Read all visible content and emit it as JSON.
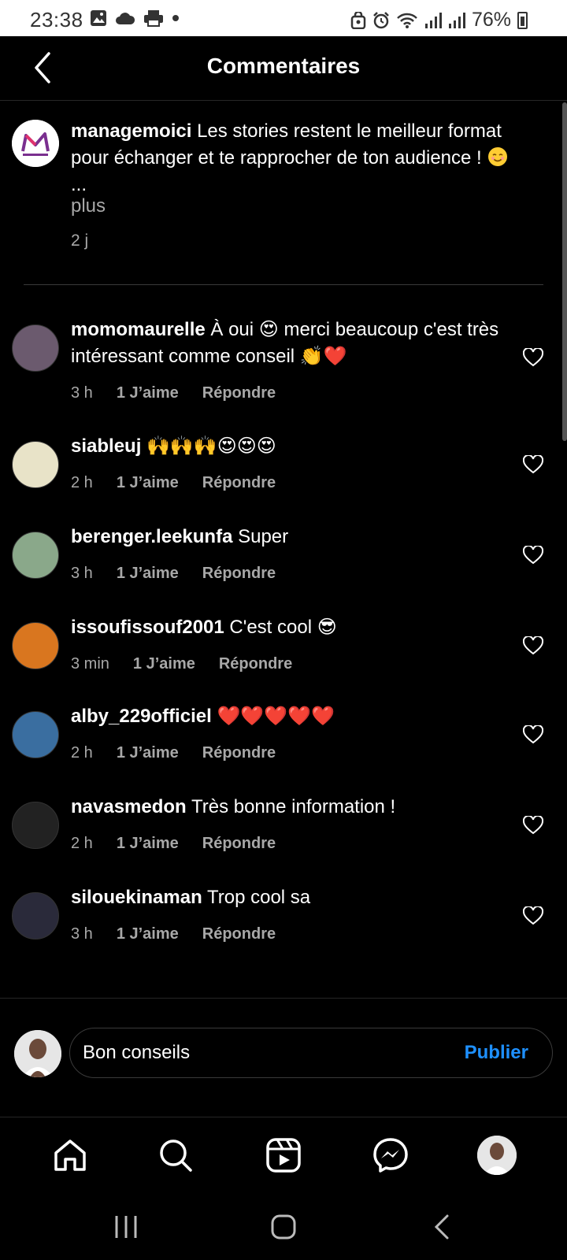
{
  "status_bar": {
    "time": "23:38",
    "battery": "76%"
  },
  "header": {
    "title": "Commentaires"
  },
  "caption": {
    "username": "managemoici",
    "text": "Les stories restent le meilleur format pour échanger et te rapprocher de ton audience !",
    "ellipsis": "...",
    "more": "plus",
    "age": "2 j"
  },
  "comments": [
    {
      "username": "momomaurelle",
      "text": "À oui 😍 merci beaucoup c'est très intéressant comme conseil 👏❤️",
      "age": "3 h",
      "likes": "1 J’aime",
      "reply": "Répondre",
      "avatar_color": "#6b5a6e"
    },
    {
      "username": "siableuj",
      "text": "🙌🙌🙌😍😍😍",
      "age": "2 h",
      "likes": "1 J’aime",
      "reply": "Répondre",
      "avatar_color": "#e8e3c8"
    },
    {
      "username": "berenger.leekunfa",
      "text": "Super",
      "age": "3 h",
      "likes": "1 J’aime",
      "reply": "Répondre",
      "avatar_color": "#8aa88a"
    },
    {
      "username": "issoufissouf2001",
      "text": "C'est cool 😎",
      "age": "3 min",
      "likes": "1 J’aime",
      "reply": "Répondre",
      "avatar_color": "#d9761f"
    },
    {
      "username": "alby_229officiel",
      "text": "❤️❤️❤️❤️❤️",
      "age": "2 h",
      "likes": "1 J’aime",
      "reply": "Répondre",
      "avatar_color": "#3a6ea0"
    },
    {
      "username": "navasmedon",
      "text": "Très bonne information !",
      "age": "2 h",
      "likes": "1 J’aime",
      "reply": "Répondre",
      "avatar_color": "#222222"
    },
    {
      "username": "silouekinaman",
      "text": "Trop cool sa",
      "age": "3 h",
      "likes": "1 J’aime",
      "reply": "Répondre",
      "avatar_color": "#2a2a3a"
    }
  ],
  "composer": {
    "value": "Bon conseils",
    "publish": "Publier"
  },
  "nav": [
    "home-icon",
    "search-icon",
    "reels-icon",
    "messenger-icon",
    "profile-avatar"
  ],
  "colors": {
    "accent": "#1e90ff",
    "background": "#000000",
    "muted": "#a8a8a8"
  }
}
